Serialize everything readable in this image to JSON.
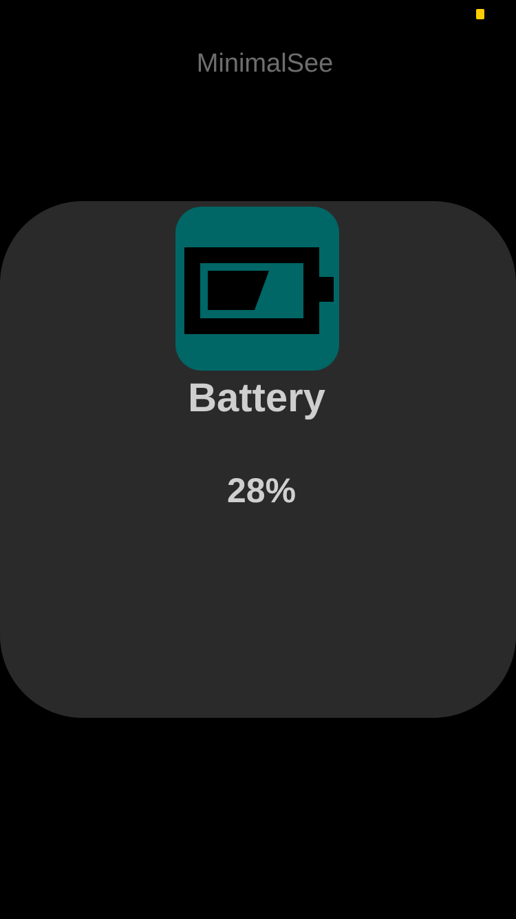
{
  "status_bar": {
    "indicator_color": "#ffcc00"
  },
  "header": {
    "title": "MinimalSee"
  },
  "card": {
    "icon": "battery-icon",
    "accent_color": "#006666",
    "title": "Battery",
    "value": "28%",
    "level_fraction": 0.28
  }
}
